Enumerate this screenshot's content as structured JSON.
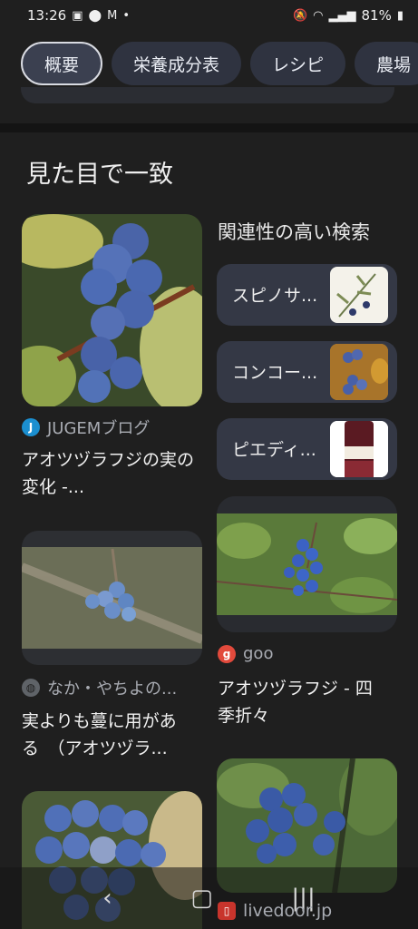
{
  "status": {
    "time": "13:26",
    "battery": "81%"
  },
  "chips": [
    "概要",
    "栄養成分表",
    "レシピ",
    "農場"
  ],
  "section_title": "見た目で一致",
  "left_column": [
    {
      "source": "JUGEMブログ",
      "title_line1": "アオツヅラフジの実の",
      "title_line2": "変化 -..."
    },
    {
      "source": "なか・やちよの...",
      "title_line1": "実よりも蔓に用があ",
      "title_line2": "る　（アオツヅラ..."
    }
  ],
  "related": {
    "heading": "関連性の高い検索",
    "items": [
      {
        "label": "スピノサ..."
      },
      {
        "label": "コンコー..."
      },
      {
        "label": "ピエディ..."
      }
    ]
  },
  "right_column": [
    {
      "source": "goo",
      "title_line1": "アオツヅラフジ - 四",
      "title_line2": "季折々"
    },
    {
      "source": "livedoor.jp"
    }
  ],
  "colors": {
    "background": "#1f1f1f",
    "chip": "#2f3340",
    "related_item": "#343845",
    "berry": "#4a6fb8"
  }
}
